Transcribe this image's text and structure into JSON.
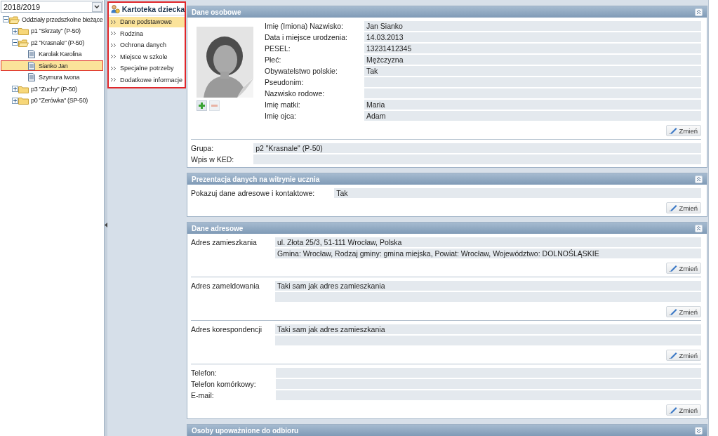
{
  "year_select": {
    "value": "2018/2019"
  },
  "tree": [
    {
      "label": "Oddziały przedszkolne bieżące",
      "kind": "folder",
      "expanded": true,
      "selected": false,
      "children": [
        {
          "label": "p1 \"Skrzaty\" (P-50)",
          "kind": "folder",
          "expanded": false,
          "selected": false
        },
        {
          "label": "p2 \"Krasnale\" (P-50)",
          "kind": "folder",
          "expanded": true,
          "selected": false,
          "children": [
            {
              "label": "Karolak Karolina",
              "kind": "student",
              "selected": false
            },
            {
              "label": "Sianko Jan",
              "kind": "student",
              "selected": true
            },
            {
              "label": "Szymura Iwona",
              "kind": "student",
              "selected": false
            }
          ]
        },
        {
          "label": "p3 \"Zuchy\" (P-50)",
          "kind": "folder",
          "expanded": false,
          "selected": false
        },
        {
          "label": "p0 \"Zerówka\" (SP-50)",
          "kind": "folder",
          "expanded": false,
          "selected": false
        }
      ]
    }
  ],
  "child_card": {
    "title": "Kartoteka dziecka",
    "items": [
      {
        "label": "Dane podstawowe",
        "selected": true
      },
      {
        "label": "Rodzina",
        "selected": false
      },
      {
        "label": "Ochrona danych",
        "selected": false
      },
      {
        "label": "Miejsce w szkole",
        "selected": false
      },
      {
        "label": "Specjalne potrzeby",
        "selected": false
      },
      {
        "label": "Dodatkowe informacje",
        "selected": false
      }
    ]
  },
  "sections": [
    {
      "title": "Dane osobowe",
      "expanded": true,
      "blocks": [
        {
          "photo_actions": [
            {
              "kind": "add",
              "disabled": false
            },
            {
              "kind": "remove",
              "disabled": true
            }
          ],
          "fields": [
            {
              "label": "Imię (Imiona) Nazwisko:",
              "value": "Jan Sianko"
            },
            {
              "label": "Data i miejsce urodzenia:",
              "value": "14.03.2013"
            },
            {
              "label": "PESEL:",
              "value": "13231412345"
            },
            {
              "label": "Płeć:",
              "value": "Mężczyzna"
            },
            {
              "label": "Obywatelstwo polskie:",
              "value": "Tak"
            },
            {
              "label": "Pseudonim:"
            },
            {
              "label": "Nazwisko rodowe:"
            },
            {
              "label": "Imię matki:",
              "value": "Maria"
            },
            {
              "label": "Imię ojca:",
              "value": "Adam"
            }
          ],
          "button": "Zmień"
        },
        {
          "kind": "fields",
          "fields": [
            {
              "label": "Grupa:",
              "value": "p2 \"Krasnale\" (P-50)"
            },
            {
              "label": "Wpis w KED:"
            }
          ]
        }
      ]
    },
    {
      "title": "Prezentacja danych na witrynie ucznia",
      "expanded": true,
      "blocks": [
        {
          "kind": "fields",
          "fields": [
            {
              "label": "Pokazuj dane adresowe i kontaktowe:",
              "value": "Tak"
            }
          ],
          "button": "Zmień"
        }
      ]
    },
    {
      "title": "Dane adresowe",
      "expanded": true,
      "blocks": [
        {
          "kind": "address",
          "label": "Adres zamieszkania",
          "lines": [
            "ul. Złota 25/3, 51-111 Wrocław, Polska",
            "Gmina: Wrocław, Rodzaj gminy: gmina miejska, Powiat: Wrocław, Województwo: DOLNOŚLĄSKIE"
          ],
          "button": "Zmień"
        },
        {
          "kind": "address",
          "label": "Adres zameldowania",
          "lines": [
            "Taki sam jak adres zamieszkania"
          ],
          "button": "Zmień"
        },
        {
          "kind": "address",
          "label": "Adres korespondencji",
          "lines": [
            "Taki sam jak adres zamieszkania"
          ],
          "button": "Zmień"
        },
        {
          "kind": "fields",
          "fields": [
            {
              "label": "Telefon:"
            },
            {
              "label": "Telefon komórkowy:"
            },
            {
              "label": "E-mail:"
            }
          ],
          "button": "Zmień"
        }
      ]
    },
    {
      "title": "Osoby upoważnione do odbioru",
      "expanded": false
    }
  ]
}
